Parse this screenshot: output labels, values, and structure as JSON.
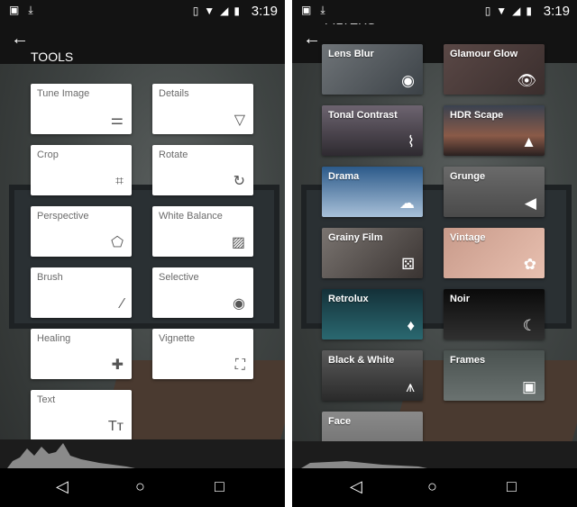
{
  "status_bar": {
    "time": "3:19",
    "left_icons": [
      "image-icon",
      "download-icon"
    ],
    "right_icons": [
      "vibrate-icon",
      "wifi-icon",
      "signal-icon",
      "battery-icon"
    ]
  },
  "tools_screen": {
    "title": "TOOLS",
    "tools": [
      {
        "label": "Tune Image",
        "icon": "sliders-icon",
        "glyph": "⚌"
      },
      {
        "label": "Details",
        "icon": "triangle-down-icon",
        "glyph": "▽"
      },
      {
        "label": "Crop",
        "icon": "crop-icon",
        "glyph": "⌗"
      },
      {
        "label": "Rotate",
        "icon": "rotate-icon",
        "glyph": "↻"
      },
      {
        "label": "Perspective",
        "icon": "perspective-icon",
        "glyph": "⬠"
      },
      {
        "label": "White Balance",
        "icon": "white-balance-icon",
        "glyph": "▨"
      },
      {
        "label": "Brush",
        "icon": "brush-icon",
        "glyph": "⁄"
      },
      {
        "label": "Selective",
        "icon": "selective-icon",
        "glyph": "◉"
      },
      {
        "label": "Healing",
        "icon": "bandage-icon",
        "glyph": "✚"
      },
      {
        "label": "Vignette",
        "icon": "vignette-icon",
        "glyph": "⛶"
      },
      {
        "label": "Text",
        "icon": "text-icon",
        "glyph": "Tт"
      }
    ]
  },
  "filters_screen": {
    "title": "FILTERS",
    "filters": [
      {
        "label": "Lens Blur",
        "icon": "target-icon",
        "glyph": "◉"
      },
      {
        "label": "Glamour Glow",
        "icon": "eye-icon",
        "glyph": "👁"
      },
      {
        "label": "Tonal Contrast",
        "icon": "pulse-icon",
        "glyph": "⌇"
      },
      {
        "label": "HDR Scape",
        "icon": "mountain-icon",
        "glyph": "▲"
      },
      {
        "label": "Drama",
        "icon": "cloud-icon",
        "glyph": "☁"
      },
      {
        "label": "Grunge",
        "icon": "megaphone-icon",
        "glyph": "◀"
      },
      {
        "label": "Grainy Film",
        "icon": "dice-icon",
        "glyph": "⚄"
      },
      {
        "label": "Vintage",
        "icon": "flower-icon",
        "glyph": "✿"
      },
      {
        "label": "Retrolux",
        "icon": "pin-icon",
        "glyph": "♦"
      },
      {
        "label": "Noir",
        "icon": "moon-icon",
        "glyph": "☾"
      },
      {
        "label": "Black & White",
        "icon": "eiffel-tower-icon",
        "glyph": "⩚"
      },
      {
        "label": "Frames",
        "icon": "frame-icon",
        "glyph": "▣"
      },
      {
        "label": "Face",
        "icon": "face-icon",
        "glyph": "☻"
      }
    ]
  },
  "nav": {
    "back": "◁",
    "home": "○",
    "recents": "□"
  }
}
